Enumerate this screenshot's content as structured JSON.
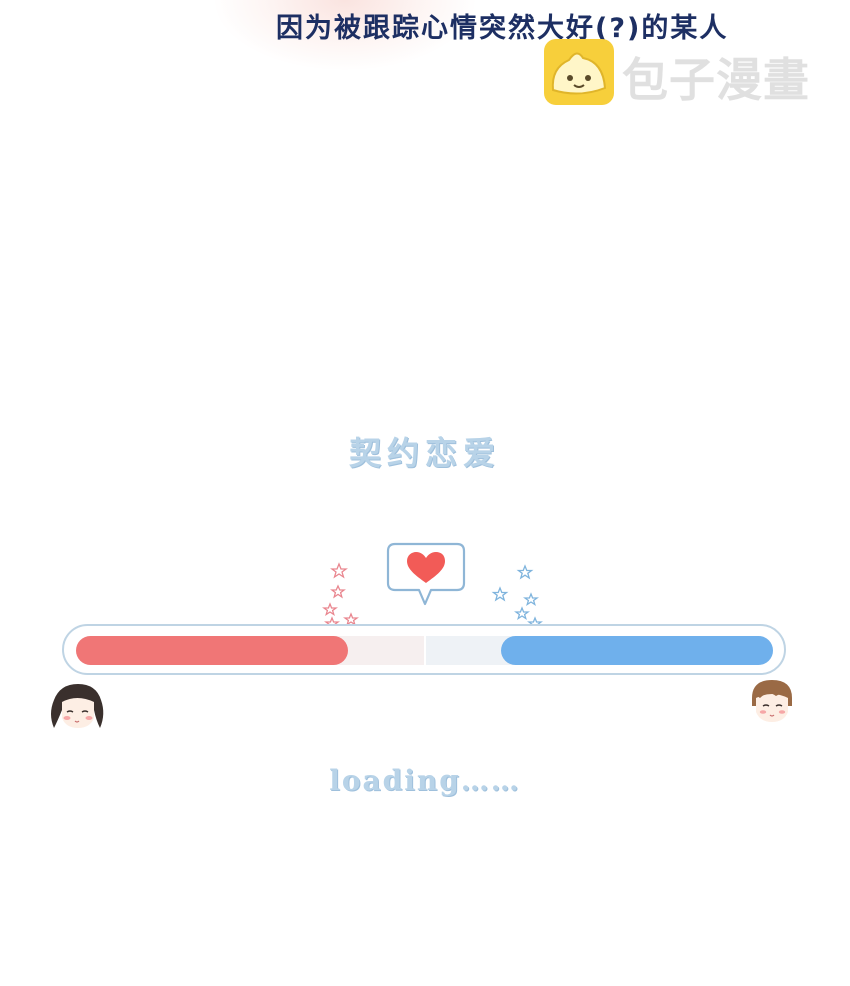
{
  "caption": "因为被跟踪心情突然大好(?)的某人",
  "watermark": {
    "text": "包子漫畫",
    "logo_icon": "steamed-bun-icon",
    "logo_color": "#f7cf3b"
  },
  "title": "契约恋爱",
  "progress": {
    "left_fill_fraction": 0.39,
    "right_fill_fraction": 0.39,
    "left_color": "#f07676",
    "right_color": "#6fb0ec"
  },
  "icons": {
    "heart": "heart-bubble-icon",
    "stars_left": "pink-stars-icon",
    "stars_right": "blue-stars-icon",
    "girl": "girl-avatar-icon",
    "boy": "boy-avatar-icon"
  },
  "loading_text": "loading……"
}
